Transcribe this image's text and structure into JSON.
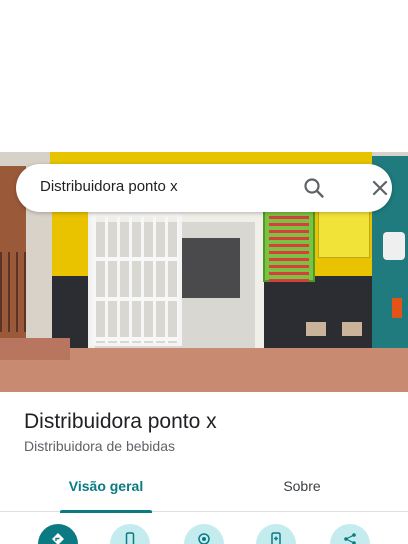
{
  "search": {
    "query": "Distribuidora ponto x"
  },
  "place": {
    "title": "Distribuidora ponto x",
    "category": "Distribuidora de bebidas"
  },
  "tabs": [
    {
      "label": "Visão geral",
      "active": true
    },
    {
      "label": "Sobre",
      "active": false
    }
  ],
  "actions": [
    {
      "icon": "directions-icon"
    },
    {
      "icon": "phone-icon"
    },
    {
      "icon": "location-icon"
    },
    {
      "icon": "add-phone-icon"
    },
    {
      "icon": "share-icon"
    }
  ],
  "colors": {
    "accent": "#0b7a83",
    "action_bg": "#c4ecef"
  }
}
